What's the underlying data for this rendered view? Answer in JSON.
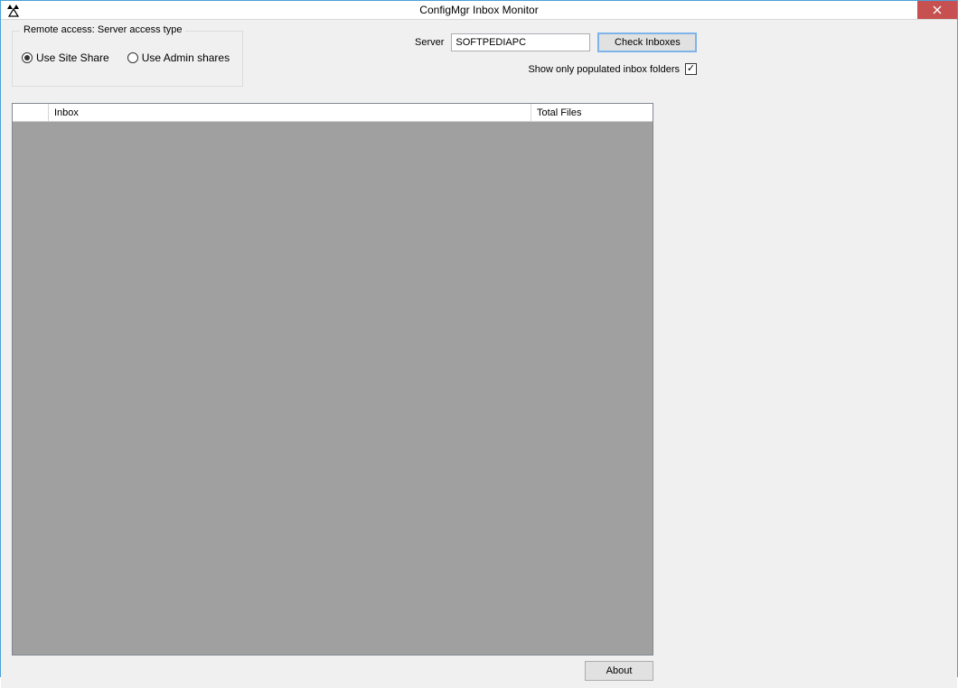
{
  "window": {
    "title": "ConfigMgr Inbox Monitor"
  },
  "remote_access": {
    "groupbox_title": "Remote access: Server access type",
    "option_site_share": "Use Site Share",
    "option_admin_shares": "Use Admin shares",
    "selected": "site_share"
  },
  "server": {
    "label": "Server",
    "value": "SOFTPEDIAPC",
    "check_button": "Check Inboxes"
  },
  "filter": {
    "show_only_populated_label": "Show only populated inbox folders",
    "show_only_populated_checked": true
  },
  "table": {
    "columns": {
      "icon": "",
      "inbox": "Inbox",
      "total_files": "Total Files"
    },
    "rows": []
  },
  "buttons": {
    "about": "About"
  }
}
